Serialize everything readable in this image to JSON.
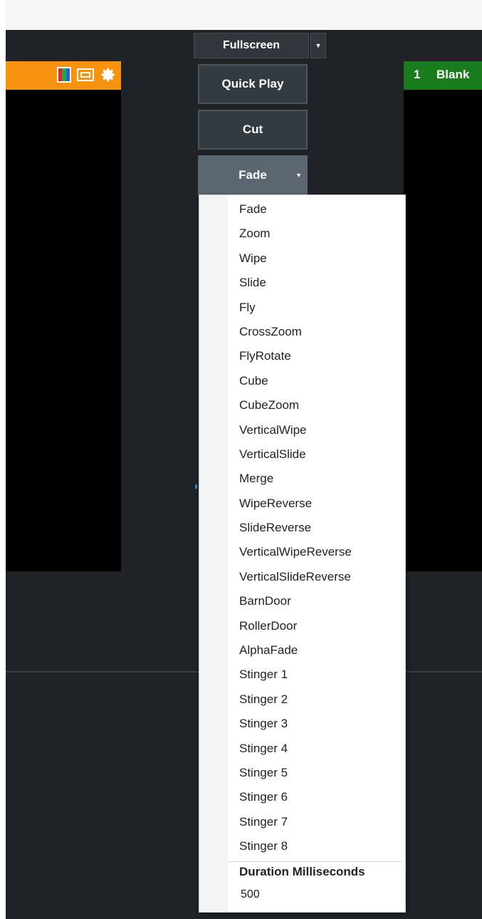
{
  "toolbar": {
    "output_mode": "Fullscreen",
    "quick_play": "Quick Play",
    "cut": "Cut",
    "transition": "Fade"
  },
  "preview": {
    "icons": [
      "color-bars-icon",
      "frame-icon",
      "gear-icon"
    ],
    "accent": "#f7930e"
  },
  "output": {
    "number": "1",
    "label": "Blank",
    "accent": "#1b7c1d"
  },
  "transition_menu": {
    "items": [
      "Fade",
      "Zoom",
      "Wipe",
      "Slide",
      "Fly",
      "CrossZoom",
      "FlyRotate",
      "Cube",
      "CubeZoom",
      "VerticalWipe",
      "VerticalSlide",
      "Merge",
      "WipeReverse",
      "SlideReverse",
      "VerticalWipeReverse",
      "VerticalSlideReverse",
      "BarnDoor",
      "RollerDoor",
      "AlphaFade",
      "Stinger 1",
      "Stinger 2",
      "Stinger 3",
      "Stinger 4",
      "Stinger 5",
      "Stinger 6",
      "Stinger 7",
      "Stinger 8"
    ],
    "duration_label": "Duration Milliseconds",
    "duration_value": "500"
  }
}
